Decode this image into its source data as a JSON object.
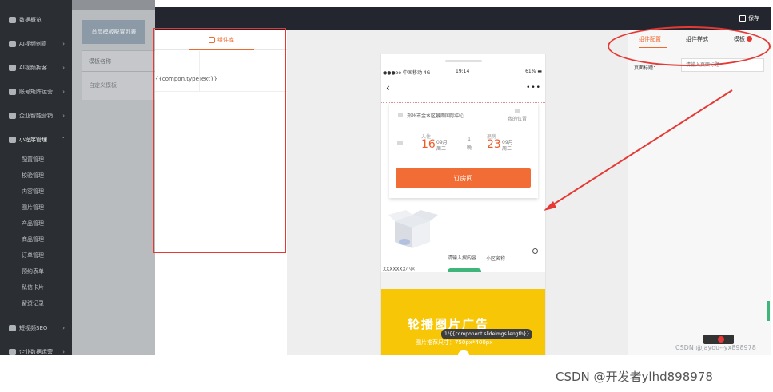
{
  "nav": {
    "items": [
      {
        "label": "数据概览"
      },
      {
        "label": "AI视频创意"
      },
      {
        "label": "AI视频拆客"
      },
      {
        "label": "账号矩阵运营"
      },
      {
        "label": "企业智能营销"
      },
      {
        "label": "小程序管理"
      }
    ],
    "sub_items": [
      "配置管理",
      "校验管理",
      "内容管理",
      "图片管理",
      "产品管理",
      "商品管理",
      "订单管理",
      "预约表单",
      "私信卡片",
      "留资记录"
    ],
    "bottom_items": [
      {
        "label": "短视频SEO"
      },
      {
        "label": "企业数据运营"
      }
    ]
  },
  "bg_page": {
    "tab_label": "首页模板配置列表",
    "column_header": "模板名称",
    "row_value": "自定义模板"
  },
  "editor": {
    "save_label": "保存",
    "library_tab": "组件库",
    "library_text": "{{compon.typeText}}"
  },
  "phone": {
    "carrier": "●●●oo 中国移动  4G",
    "time": "19:14",
    "battery": "61%",
    "address": "郑州市金水区暴雨国际中心",
    "nav_link": "我的位置",
    "checkin_label": "入住",
    "checkin_day": "16",
    "checkin_meta": "09月 周三",
    "nights": "1 晚",
    "checkout_label": "退房",
    "checkout_day": "23",
    "checkout_meta": "09月 周三",
    "book_button": "订房间",
    "search_hint": "请输入搜内容",
    "community_label": "小区名称",
    "small_area": "XXXXXXX小区",
    "banner_title": "轮播图片广告",
    "banner_sub": "图片推荐尺寸：750px*400px",
    "banner_tip": "1/{{component.slideimgs.length}}"
  },
  "right_panel": {
    "tabs": [
      "组件配置",
      "组件样式",
      "模板"
    ],
    "field_label": "页面标题：",
    "field_placeholder": "请输入页面标题",
    "inner_watermark": "CSDN @jayou--yx898978"
  },
  "footer_watermark": "CSDN @开发者ylhd898978"
}
